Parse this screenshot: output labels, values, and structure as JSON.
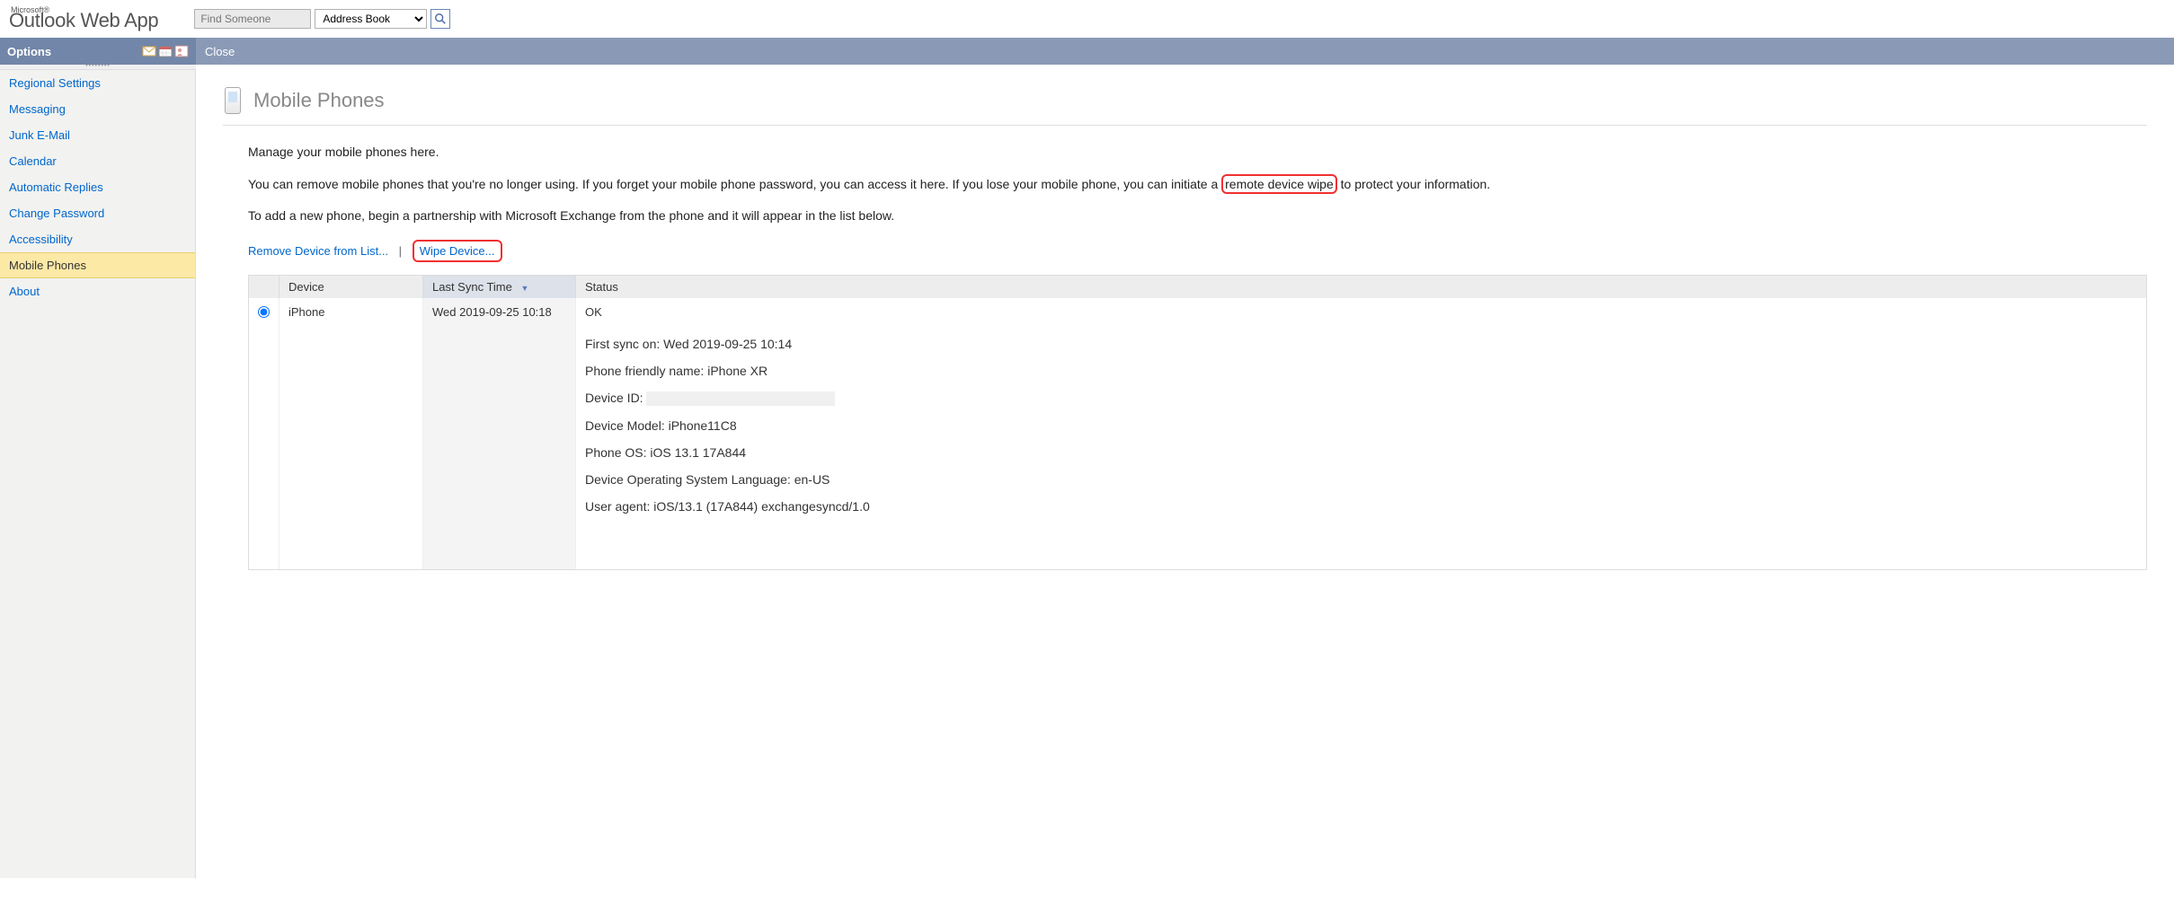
{
  "branding": {
    "ms": "Microsoft®",
    "app": "Outlook Web App"
  },
  "search": {
    "placeholder": "Find Someone",
    "addressbook": "Address Book"
  },
  "sidebar": {
    "title": "Options",
    "items": [
      {
        "label": "Regional Settings",
        "selected": false
      },
      {
        "label": "Messaging",
        "selected": false
      },
      {
        "label": "Junk E-Mail",
        "selected": false
      },
      {
        "label": "Calendar",
        "selected": false
      },
      {
        "label": "Automatic Replies",
        "selected": false
      },
      {
        "label": "Change Password",
        "selected": false
      },
      {
        "label": "Accessibility",
        "selected": false
      },
      {
        "label": "Mobile Phones",
        "selected": true
      },
      {
        "label": "About",
        "selected": false
      }
    ]
  },
  "header": {
    "close": "Close"
  },
  "page": {
    "title": "Mobile Phones",
    "intro1": "Manage your mobile phones here.",
    "intro2a": "You can remove mobile phones that you're no longer using. If you forget your mobile phone password, you can access it here. If you lose your mobile phone, you can initiate a ",
    "intro2b": "remote device wipe",
    "intro2c": " to protect your information.",
    "intro3": "To add a new phone, begin a partnership with Microsoft Exchange from the phone and it will appear in the list below."
  },
  "actions": {
    "remove": "Remove Device from List...",
    "sep": "|",
    "wipe": "Wipe Device..."
  },
  "table": {
    "headers": {
      "device": "Device",
      "last_sync": "Last Sync Time",
      "status": "Status"
    },
    "row": {
      "device": "iPhone",
      "last_sync": "Wed 2019-09-25 10:18",
      "status": "OK",
      "details": {
        "first_sync_label": "First sync on:",
        "first_sync_value": "Wed 2019-09-25 10:14",
        "friendly_label": "Phone friendly name:",
        "friendly_value": "iPhone XR",
        "device_id_label": "Device ID:",
        "model_label": "Device Model:",
        "model_value": "iPhone11C8",
        "os_label": "Phone OS:",
        "os_value": "iOS 13.1 17A844",
        "lang_label": "Device Operating System Language:",
        "lang_value": "en-US",
        "ua_label": "User agent:",
        "ua_value": "iOS/13.1 (17A844) exchangesyncd/1.0"
      }
    }
  }
}
